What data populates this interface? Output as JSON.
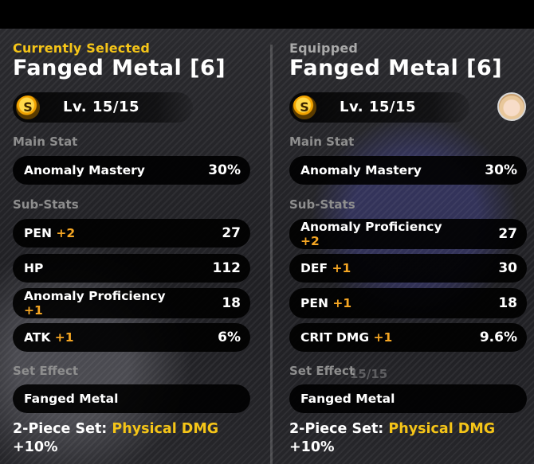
{
  "left": {
    "header_tag": "Currently Selected",
    "disc_name": "Fanged Metal [6]",
    "rank_badge": "S",
    "level": "Lv. 15/15",
    "main_stat_label": "Main Stat",
    "main_stat": {
      "name": "Anomaly Mastery",
      "value": "30%"
    },
    "sub_stats_label": "Sub-Stats",
    "sub_stats": [
      {
        "name": "PEN",
        "plus": "+2",
        "value": "27"
      },
      {
        "name": "HP",
        "plus": "",
        "value": "112"
      },
      {
        "name": "Anomaly Proficiency",
        "plus": "+1",
        "value": "18"
      },
      {
        "name": "ATK",
        "plus": "+1",
        "value": "6%"
      }
    ],
    "set_effect_label": "Set Effect",
    "set_name": "Fanged Metal",
    "set_desc_prefix": "2-Piece Set:",
    "set_desc_highlight": "Physical DMG",
    "set_desc_value": "+10%"
  },
  "right": {
    "header_tag": "Equipped",
    "disc_name": "Fanged Metal [6]",
    "rank_badge": "S",
    "level": "Lv. 15/15",
    "avatar_icon": "character-avatar-icon",
    "main_stat_label": "Main Stat",
    "main_stat": {
      "name": "Anomaly Mastery",
      "value": "30%"
    },
    "sub_stats_label": "Sub-Stats",
    "sub_stats": [
      {
        "name": "Anomaly Proficiency",
        "plus": "+2",
        "value": "27"
      },
      {
        "name": "DEF",
        "plus": "+1",
        "value": "30"
      },
      {
        "name": "PEN",
        "plus": "+1",
        "value": "18"
      },
      {
        "name": "CRIT DMG",
        "plus": "+1",
        "value": "9.6%"
      }
    ],
    "set_effect_label": "Set Effect",
    "ghost_level": "15/15",
    "set_name": "Fanged Metal",
    "set_desc_prefix": "2-Piece Set:",
    "set_desc_highlight": "Physical DMG",
    "set_desc_value": "+10%"
  },
  "colors": {
    "highlight": "#f5c518",
    "plus": "#f5a623",
    "muted": "#8e8e8e"
  }
}
